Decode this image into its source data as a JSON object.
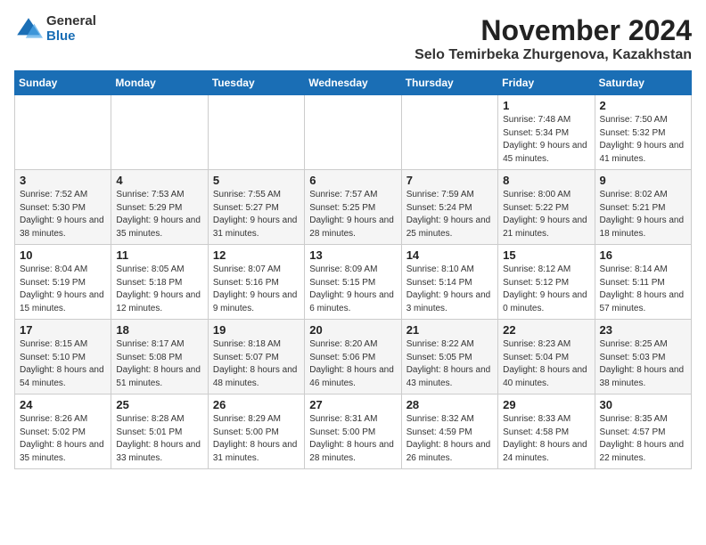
{
  "logo": {
    "general": "General",
    "blue": "Blue"
  },
  "title": "November 2024",
  "location": "Selo Temirbeka Zhurgenova, Kazakhstan",
  "days_of_week": [
    "Sunday",
    "Monday",
    "Tuesday",
    "Wednesday",
    "Thursday",
    "Friday",
    "Saturday"
  ],
  "weeks": [
    [
      {
        "day": "",
        "info": ""
      },
      {
        "day": "",
        "info": ""
      },
      {
        "day": "",
        "info": ""
      },
      {
        "day": "",
        "info": ""
      },
      {
        "day": "",
        "info": ""
      },
      {
        "day": "1",
        "info": "Sunrise: 7:48 AM\nSunset: 5:34 PM\nDaylight: 9 hours\nand 45 minutes."
      },
      {
        "day": "2",
        "info": "Sunrise: 7:50 AM\nSunset: 5:32 PM\nDaylight: 9 hours\nand 41 minutes."
      }
    ],
    [
      {
        "day": "3",
        "info": "Sunrise: 7:52 AM\nSunset: 5:30 PM\nDaylight: 9 hours\nand 38 minutes."
      },
      {
        "day": "4",
        "info": "Sunrise: 7:53 AM\nSunset: 5:29 PM\nDaylight: 9 hours\nand 35 minutes."
      },
      {
        "day": "5",
        "info": "Sunrise: 7:55 AM\nSunset: 5:27 PM\nDaylight: 9 hours\nand 31 minutes."
      },
      {
        "day": "6",
        "info": "Sunrise: 7:57 AM\nSunset: 5:25 PM\nDaylight: 9 hours\nand 28 minutes."
      },
      {
        "day": "7",
        "info": "Sunrise: 7:59 AM\nSunset: 5:24 PM\nDaylight: 9 hours\nand 25 minutes."
      },
      {
        "day": "8",
        "info": "Sunrise: 8:00 AM\nSunset: 5:22 PM\nDaylight: 9 hours\nand 21 minutes."
      },
      {
        "day": "9",
        "info": "Sunrise: 8:02 AM\nSunset: 5:21 PM\nDaylight: 9 hours\nand 18 minutes."
      }
    ],
    [
      {
        "day": "10",
        "info": "Sunrise: 8:04 AM\nSunset: 5:19 PM\nDaylight: 9 hours\nand 15 minutes."
      },
      {
        "day": "11",
        "info": "Sunrise: 8:05 AM\nSunset: 5:18 PM\nDaylight: 9 hours\nand 12 minutes."
      },
      {
        "day": "12",
        "info": "Sunrise: 8:07 AM\nSunset: 5:16 PM\nDaylight: 9 hours\nand 9 minutes."
      },
      {
        "day": "13",
        "info": "Sunrise: 8:09 AM\nSunset: 5:15 PM\nDaylight: 9 hours\nand 6 minutes."
      },
      {
        "day": "14",
        "info": "Sunrise: 8:10 AM\nSunset: 5:14 PM\nDaylight: 9 hours\nand 3 minutes."
      },
      {
        "day": "15",
        "info": "Sunrise: 8:12 AM\nSunset: 5:12 PM\nDaylight: 9 hours\nand 0 minutes."
      },
      {
        "day": "16",
        "info": "Sunrise: 8:14 AM\nSunset: 5:11 PM\nDaylight: 8 hours\nand 57 minutes."
      }
    ],
    [
      {
        "day": "17",
        "info": "Sunrise: 8:15 AM\nSunset: 5:10 PM\nDaylight: 8 hours\nand 54 minutes."
      },
      {
        "day": "18",
        "info": "Sunrise: 8:17 AM\nSunset: 5:08 PM\nDaylight: 8 hours\nand 51 minutes."
      },
      {
        "day": "19",
        "info": "Sunrise: 8:18 AM\nSunset: 5:07 PM\nDaylight: 8 hours\nand 48 minutes."
      },
      {
        "day": "20",
        "info": "Sunrise: 8:20 AM\nSunset: 5:06 PM\nDaylight: 8 hours\nand 46 minutes."
      },
      {
        "day": "21",
        "info": "Sunrise: 8:22 AM\nSunset: 5:05 PM\nDaylight: 8 hours\nand 43 minutes."
      },
      {
        "day": "22",
        "info": "Sunrise: 8:23 AM\nSunset: 5:04 PM\nDaylight: 8 hours\nand 40 minutes."
      },
      {
        "day": "23",
        "info": "Sunrise: 8:25 AM\nSunset: 5:03 PM\nDaylight: 8 hours\nand 38 minutes."
      }
    ],
    [
      {
        "day": "24",
        "info": "Sunrise: 8:26 AM\nSunset: 5:02 PM\nDaylight: 8 hours\nand 35 minutes."
      },
      {
        "day": "25",
        "info": "Sunrise: 8:28 AM\nSunset: 5:01 PM\nDaylight: 8 hours\nand 33 minutes."
      },
      {
        "day": "26",
        "info": "Sunrise: 8:29 AM\nSunset: 5:00 PM\nDaylight: 8 hours\nand 31 minutes."
      },
      {
        "day": "27",
        "info": "Sunrise: 8:31 AM\nSunset: 5:00 PM\nDaylight: 8 hours\nand 28 minutes."
      },
      {
        "day": "28",
        "info": "Sunrise: 8:32 AM\nSunset: 4:59 PM\nDaylight: 8 hours\nand 26 minutes."
      },
      {
        "day": "29",
        "info": "Sunrise: 8:33 AM\nSunset: 4:58 PM\nDaylight: 8 hours\nand 24 minutes."
      },
      {
        "day": "30",
        "info": "Sunrise: 8:35 AM\nSunset: 4:57 PM\nDaylight: 8 hours\nand 22 minutes."
      }
    ]
  ]
}
